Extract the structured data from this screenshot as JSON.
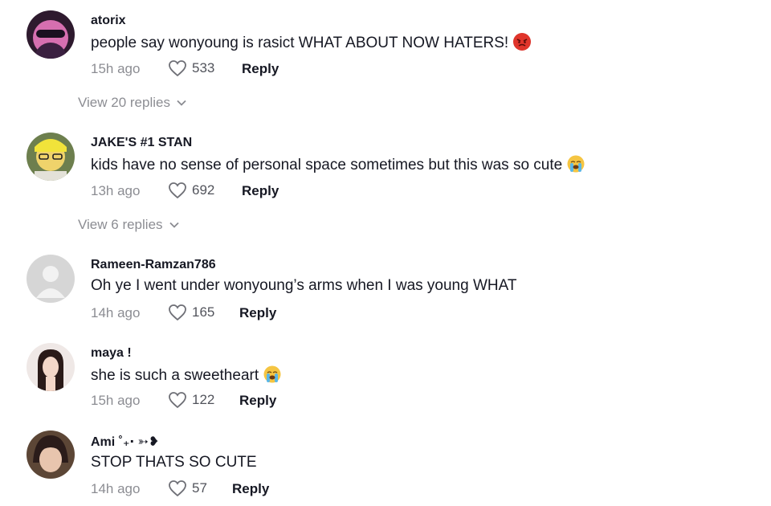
{
  "view_replies_1": "View 20 replies",
  "view_replies_2": "View 6 replies",
  "comments": [
    {
      "username": "atorix",
      "text": "people say wonyoung is rasict WHAT ABOUT NOW HATERS!",
      "emoji": "angry-face-icon",
      "time": "15h ago",
      "likes": "533",
      "reply_label": "Reply"
    },
    {
      "username": "JAKE'S #1 STAN",
      "text": "kids have no sense of personal space sometimes but this was so cute",
      "emoji": "loudly-crying-face-icon",
      "time": "13h ago",
      "likes": "692",
      "reply_label": "Reply"
    },
    {
      "username": "Rameen-Ramzan786",
      "text": "Oh ye I went under wonyoung’s arms when I was young WHAT",
      "time": "14h ago",
      "likes": "165",
      "reply_label": "Reply"
    },
    {
      "username": "maya !",
      "text": "she is such a sweetheart",
      "emoji": "loudly-crying-face-icon",
      "time": "15h ago",
      "likes": "122",
      "reply_label": "Reply"
    },
    {
      "username": "Ami ˚₊‧ ➳❥",
      "text": "STOP THATS SO CUTE",
      "time": "14h ago",
      "likes": "57",
      "reply_label": "Reply"
    }
  ],
  "colors": {
    "text": "#161823",
    "secondary": "rgba(22,24,35,0.5)",
    "background": "#ffffff"
  }
}
